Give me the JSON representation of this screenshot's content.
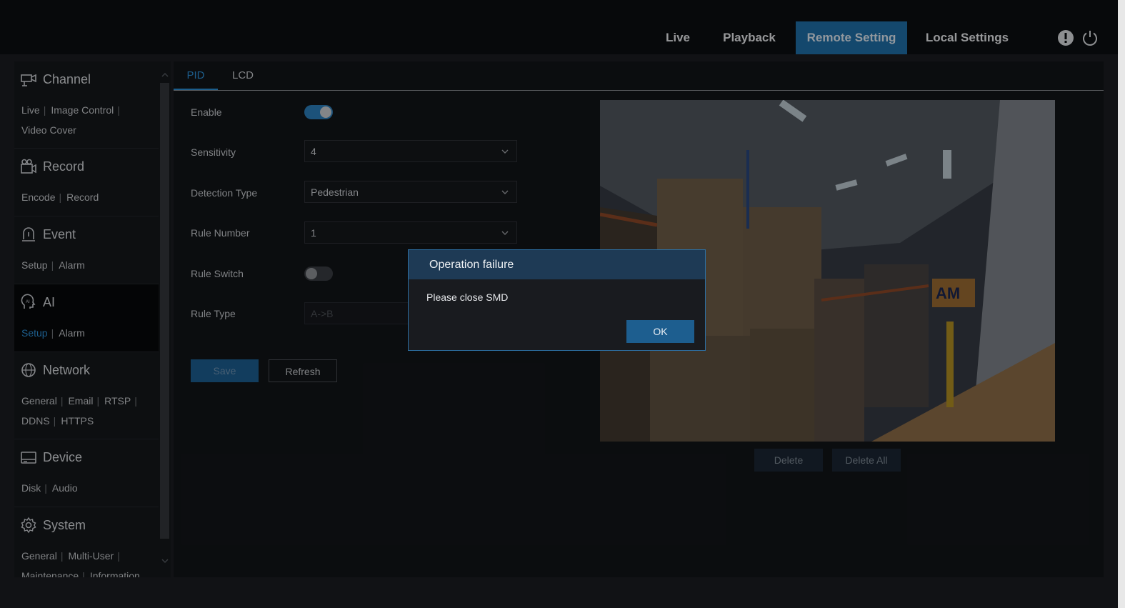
{
  "topnav": {
    "items": [
      {
        "label": "Live"
      },
      {
        "label": "Playback"
      },
      {
        "label": "Remote Setting",
        "active": true
      },
      {
        "label": "Local Settings"
      }
    ],
    "icons": [
      "alert-icon",
      "power-icon"
    ]
  },
  "sidebar": {
    "sections": [
      {
        "title": "Channel",
        "icon": "channel-icon",
        "links": [
          "Live",
          "Image Control",
          "Video Cover"
        ]
      },
      {
        "title": "Record",
        "icon": "record-icon",
        "links": [
          "Encode",
          "Record"
        ]
      },
      {
        "title": "Event",
        "icon": "event-icon",
        "links": [
          "Setup",
          "Alarm"
        ]
      },
      {
        "title": "AI",
        "icon": "ai-icon",
        "active": true,
        "links": [
          "Setup",
          "Alarm"
        ],
        "active_link": "Setup"
      },
      {
        "title": "Network",
        "icon": "network-icon",
        "links": [
          "General",
          "Email",
          "RTSP",
          "DDNS",
          "HTTPS"
        ]
      },
      {
        "title": "Device",
        "icon": "device-icon",
        "links": [
          "Disk",
          "Audio"
        ]
      },
      {
        "title": "System",
        "icon": "system-icon",
        "links": [
          "General",
          "Multi-User",
          "Maintenance",
          "Information"
        ]
      }
    ]
  },
  "tabs": [
    {
      "label": "PID",
      "active": true
    },
    {
      "label": "LCD"
    }
  ],
  "form": {
    "enable_label": "Enable",
    "enable_on": true,
    "sensitivity_label": "Sensitivity",
    "sensitivity_value": "4",
    "detection_type_label": "Detection Type",
    "detection_type_value": "Pedestrian",
    "rule_number_label": "Rule Number",
    "rule_number_value": "1",
    "rule_switch_label": "Rule Switch",
    "rule_switch_on": false,
    "rule_type_label": "Rule Type",
    "rule_type_value": "A->B",
    "save_label": "Save",
    "refresh_label": "Refresh"
  },
  "preview": {
    "delete_label": "Delete",
    "delete_all_label": "Delete All",
    "banner_text": "AM"
  },
  "dialog": {
    "title": "Operation failure",
    "message": "Please close SMD",
    "ok_label": "OK"
  },
  "colors": {
    "accent": "#2c8fd6",
    "active_nav": "#1f6fa8",
    "background": "#121418"
  }
}
